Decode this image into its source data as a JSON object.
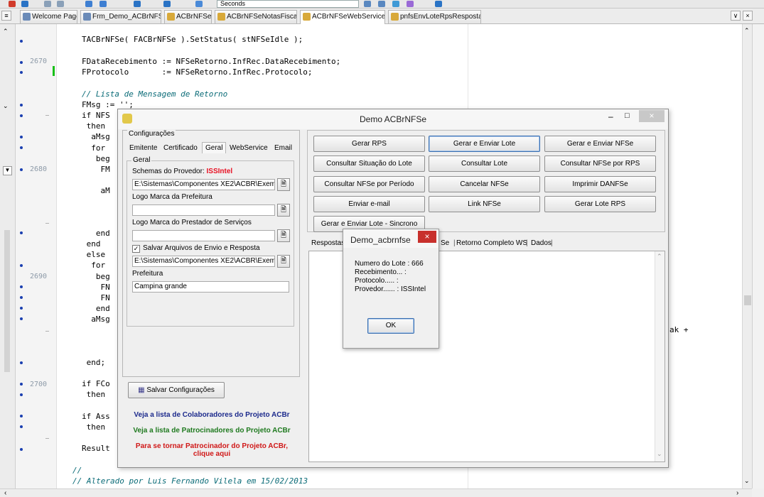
{
  "toolbar": {
    "combo_value": "Seconds"
  },
  "tabs": [
    {
      "label": "Welcome Page",
      "active": false
    },
    {
      "label": "Frm_Demo_ACBrNFSe",
      "active": false
    },
    {
      "label": "ACBrNFSe",
      "active": false
    },
    {
      "label": "ACBrNFSeNotasFiscais",
      "active": false
    },
    {
      "label": "ACBrNFSeWebServices",
      "active": true
    },
    {
      "label": "pnfsEnvLoteRpsResposta",
      "active": false
    }
  ],
  "gutter": {
    "line_numbers": [
      "2670",
      "2680",
      "2690",
      "2700"
    ]
  },
  "code_lines": [
    "TACBrNFSe( FACBrNFSe ).SetStatus( stNFSeIdle );",
    "FDataRecebimento := NFSeRetorno.InfRec.DataRecebimento;",
    "FProtocolo       := NFSeRetorno.InfRec.Protocolo;",
    "// Lista de Mensagem de Retorno",
    "FMsg := '';",
    "if NFS",
    " then",
    "  aMsg",
    "  for",
    "   beg",
    "    FM",
    "    aM",
    "   end",
    " end",
    " else",
    "  for",
    "   beg",
    "    FN",
    "    FN",
    "   end",
    "  aMsg",
    "ak +",
    " end;",
    "if FCo",
    " then",
    "if Ass",
    " then",
    "Result",
    "//",
    "// Alterado por Luis Fernando Vilela em 15/02/2013"
  ],
  "dialog": {
    "title": "Demo ACBrNFSe",
    "config_group": "Configurações",
    "config_tabs": [
      "Emitente",
      "Certificado",
      "Geral",
      "WebService",
      "Email"
    ],
    "geral_group": "Geral",
    "schemas_label": "Schemas do Provedor:",
    "schemas_provider": "ISSIntel",
    "schemas_value": "E:\\Sistemas\\Componentes XE2\\ACBR\\Exemp",
    "logo_prefeitura_label": "Logo Marca da Prefeitura",
    "logo_prefeitura_value": "",
    "logo_prestador_label": "Logo Marca do Prestador de Serviços",
    "logo_prestador_value": "",
    "salvar_arquivos_label": "Salvar Arquivos de Envio e Resposta",
    "salvar_arquivos_checked": true,
    "salvar_path_value": "E:\\Sistemas\\Componentes XE2\\ACBR\\Exemp",
    "prefeitura_label": "Prefeitura",
    "prefeitura_value": "Campina grande",
    "save_config_button": "Salvar Configurações",
    "link_colaboradores": "Veja a lista de Colaboradores do Projeto ACBr",
    "link_patrocinadores": "Veja a lista de Patrocinadores do Projeto ACBr",
    "link_tornar_line1": "Para se tornar Patrocinador do Projeto ACBr,",
    "link_tornar_line2": "clique aqui",
    "action_buttons": [
      "Gerar RPS",
      "Gerar e Enviar Lote",
      "Gerar e Enviar NFSe",
      "Consultar Situação do Lote",
      "Consultar Lote",
      "Consultar NFSe por RPS",
      "Consultar NFSe por Período",
      "Cancelar NFSe",
      "Imprimir DANFSe",
      "Enviar e-mail",
      "Link NFSe",
      "Gerar Lote RPS",
      "Gerar e Enviar Lote - Sincrono"
    ],
    "result_tabs": [
      "Respostas",
      "Se",
      "Retorno Completo WS",
      "Dados"
    ]
  },
  "popup": {
    "title": "Demo_acbrnfse",
    "lines": [
      "Numero do Lote : 666",
      "Recebimento... :",
      "Protocolo..... :",
      "Provedor...... : ISSIntel"
    ],
    "ok_label": "OK"
  },
  "colors": {
    "accent_red": "#e81123",
    "link_blue": "#1c2a8c",
    "link_green": "#1f7a1f",
    "link_red": "#d01818",
    "comment": "#0a6b77"
  }
}
